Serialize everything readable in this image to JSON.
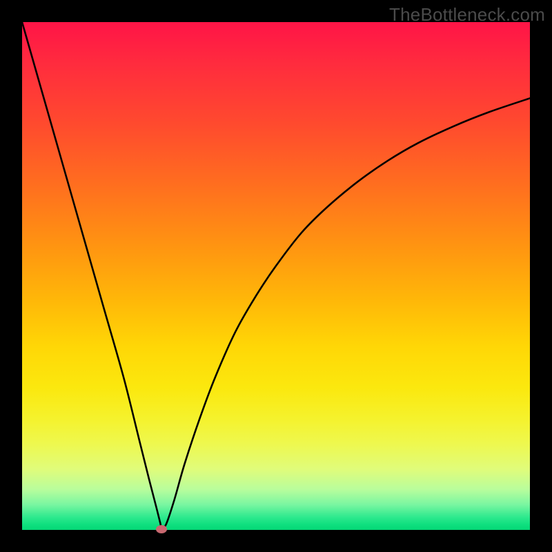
{
  "watermark": "TheBottleneck.com",
  "chart_data": {
    "type": "line",
    "title": "",
    "xlabel": "",
    "ylabel": "",
    "xlim": [
      0,
      100
    ],
    "ylim": [
      0,
      100
    ],
    "series": [
      {
        "name": "curve",
        "x": [
          0,
          4,
          8,
          12,
          16,
          20,
          23,
          25,
          26.5,
          27.2,
          27.5,
          28.4,
          30,
          32,
          35,
          38,
          42,
          46,
          50,
          55,
          60,
          66,
          72,
          78,
          85,
          92,
          100
        ],
        "y": [
          100,
          86,
          72,
          58,
          44,
          30,
          18,
          10,
          4.2,
          1.4,
          0.3,
          1.2,
          6,
          13,
          22,
          30,
          39,
          46,
          52,
          58.5,
          63.5,
          68.5,
          72.7,
          76.2,
          79.5,
          82.3,
          85
        ]
      }
    ],
    "marker": {
      "x": 27.4,
      "y": 0.15
    },
    "grid": false,
    "legend": false
  }
}
